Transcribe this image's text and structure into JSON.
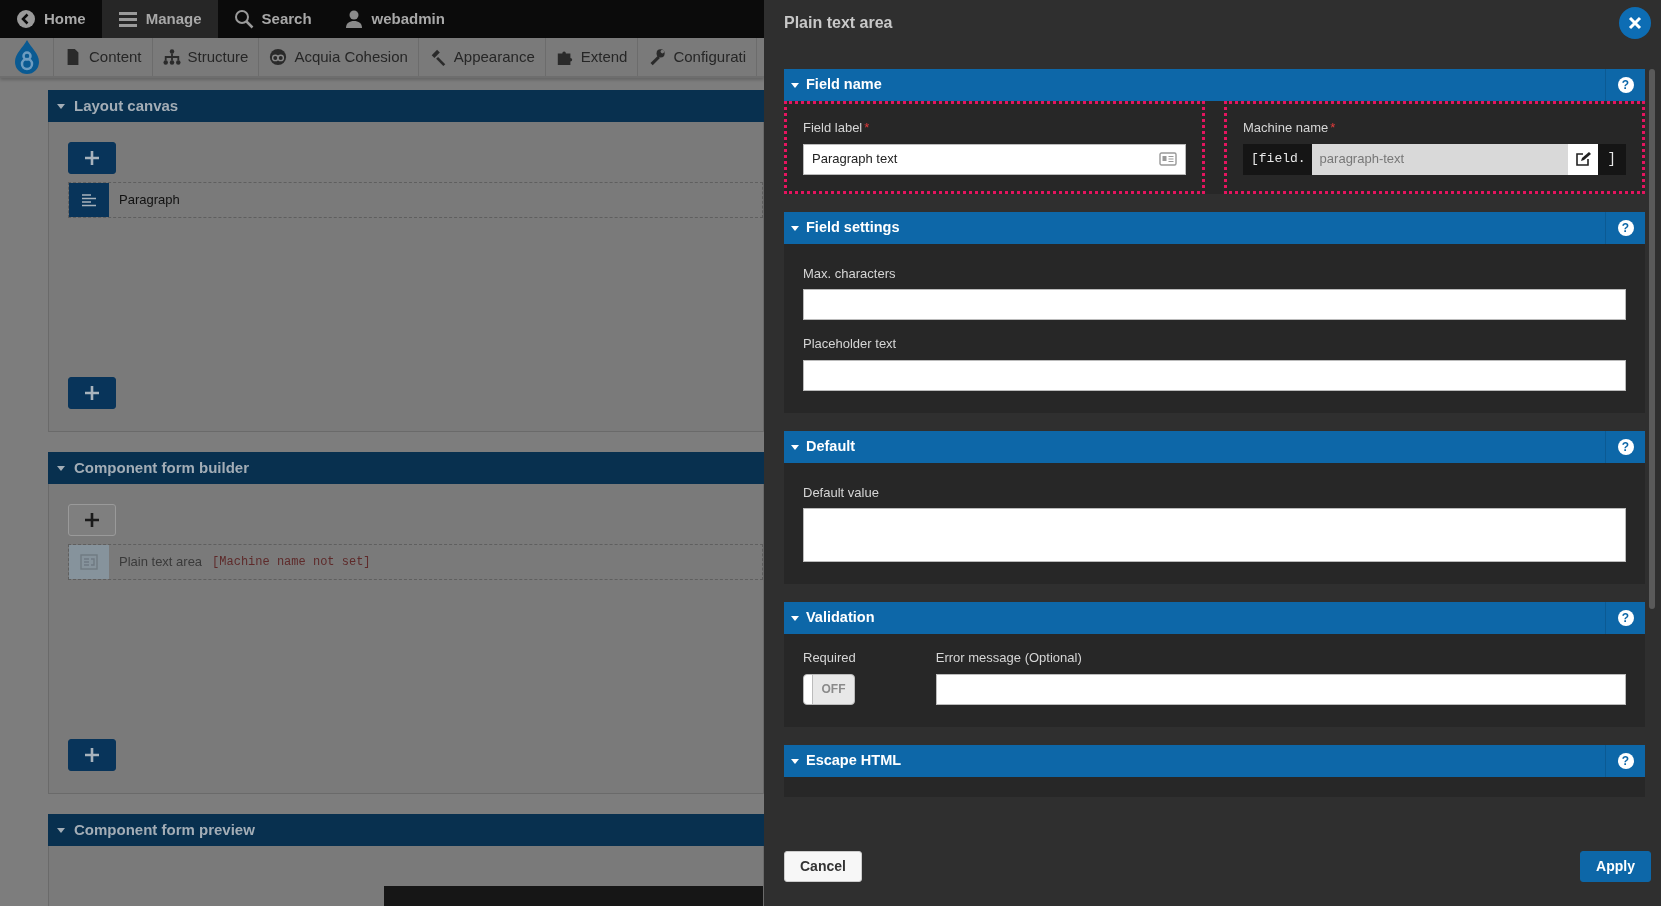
{
  "toolbar": [
    {
      "label": "Home",
      "selected": false
    },
    {
      "label": "Manage",
      "selected": true
    },
    {
      "label": "Search",
      "selected": false
    },
    {
      "label": "webadmin",
      "selected": false
    }
  ],
  "admin_menu": [
    {
      "label": "Content"
    },
    {
      "label": "Structure"
    },
    {
      "label": "Acquia Cohesion"
    },
    {
      "label": "Appearance"
    },
    {
      "label": "Extend"
    },
    {
      "label": "Configurati"
    }
  ],
  "panels": [
    {
      "title": "Layout canvas",
      "top_button_outlined": false,
      "items": [
        {
          "label": "Paragraph",
          "faded": false
        }
      ]
    },
    {
      "title": "Component form builder",
      "top_button_outlined": true,
      "items": [
        {
          "label": "Plain text area",
          "machine_name": "[Machine name not set]",
          "faded": true
        }
      ]
    },
    {
      "title": "Component form preview"
    }
  ],
  "modal": {
    "title": "Plain text area",
    "sections": [
      {
        "title": "Field name",
        "help": "?",
        "fields": [
          {
            "kind": "text",
            "label": "Field label",
            "required_mark": "*",
            "value": "Paragraph text",
            "highlighted": true
          },
          {
            "kind": "machine",
            "label": "Machine name",
            "required_mark": "*",
            "prefix": "[field.",
            "value": "paragraph-text",
            "suffix": "]",
            "highlighted": true
          }
        ]
      },
      {
        "title": "Field settings",
        "help": "?",
        "fields": [
          {
            "kind": "text",
            "label": "Max. characters",
            "highlighted": false
          },
          {
            "kind": "text",
            "label": "Placeholder text",
            "highlighted": false
          }
        ]
      },
      {
        "title": "Default",
        "help": "?",
        "fields": [
          {
            "kind": "textarea",
            "label": "Default value"
          }
        ]
      },
      {
        "title": "Validation",
        "help": "?",
        "fields": [
          {
            "kind": "toggle",
            "label": "Required",
            "on": false,
            "state_text": "OFF"
          },
          {
            "kind": "text",
            "label": "Error message (Optional)",
            "highlighted": false
          }
        ]
      },
      {
        "title": "Escape HTML",
        "help": "?"
      }
    ],
    "buttons": [
      {
        "label": "Cancel",
        "kind": "secondary"
      },
      {
        "label": "Apply",
        "kind": "primary"
      }
    ]
  }
}
